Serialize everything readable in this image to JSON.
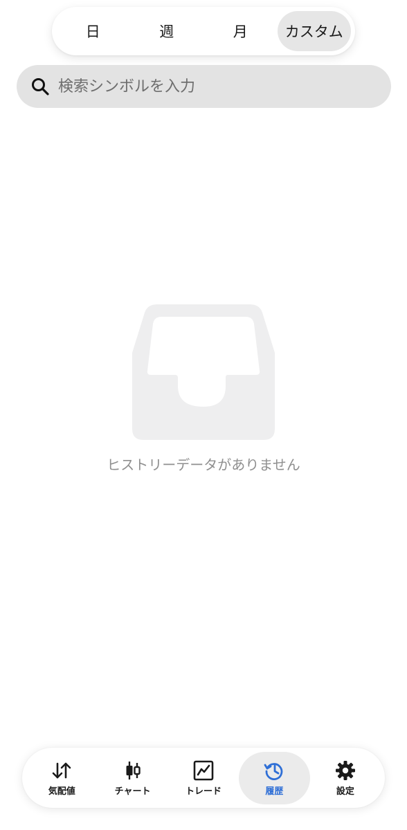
{
  "period_tabs": [
    {
      "label": "日"
    },
    {
      "label": "週"
    },
    {
      "label": "月"
    },
    {
      "label": "カスタム",
      "active": true
    }
  ],
  "search": {
    "placeholder": "検索シンボルを入力",
    "icon": "search-icon"
  },
  "empty_state": {
    "icon": "inbox-tray-icon",
    "message": "ヒストリーデータがありません"
  },
  "tabbar": {
    "items": [
      {
        "label": "気配値",
        "icon": "up-down-arrows-icon"
      },
      {
        "label": "チャート",
        "icon": "candlestick-icon"
      },
      {
        "label": "トレード",
        "icon": "trend-chart-icon"
      },
      {
        "label": "履歴",
        "icon": "history-clock-icon",
        "active": true
      },
      {
        "label": "設定",
        "icon": "gear-icon"
      }
    ]
  },
  "colors": {
    "accent": "#2f6fd6",
    "active_bg": "#e6e6e6",
    "empty_art": "#eeeeef",
    "muted_text": "#8f8f8f"
  }
}
